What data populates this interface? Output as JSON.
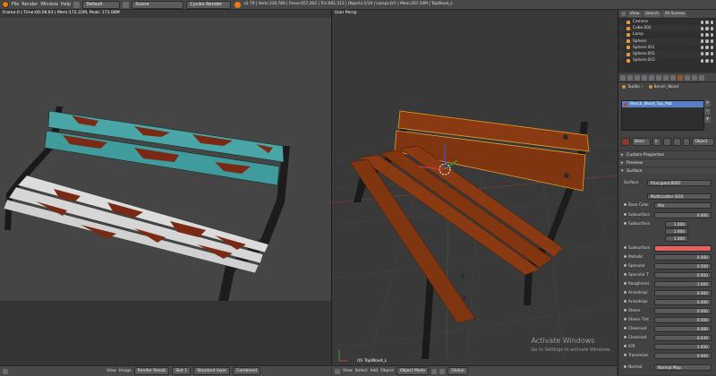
{
  "topbar": {
    "menus": [
      "File",
      "Render",
      "Window",
      "Help"
    ],
    "layout": "Default",
    "scene": "Scene",
    "engine": "Cycles Render",
    "stats": "v2.79 | Verts:330,780 | Faces:657,462 | Tris:661,512 | Objects:1/19 | Lamps:0/1 | Mem:267.10M | TopWood_L"
  },
  "left_viewport": {
    "header": "Frame:0 | Time:00:28.63 | Mem:172.22M, Peak: 173.08M",
    "bottom_items": [
      "View",
      "Image",
      "Render Result",
      "Slot 1",
      "Standard layer",
      "Combined"
    ]
  },
  "right_viewport": {
    "header": "User Persp",
    "footer": "(0) TopWood_L",
    "bottom_items": [
      "View",
      "Select",
      "Add",
      "Object",
      "Object Mode",
      "Global"
    ]
  },
  "watermark": {
    "line1": "Activate Windows",
    "line2": "Go to Settings to activate Windows."
  },
  "outliner": {
    "view": "View",
    "search": "Search",
    "filter": "All Scenes",
    "items": [
      "Camera",
      "Cube.002",
      "Lamp",
      "Sphere",
      "Sphere.001",
      "Sphere.002",
      "Sphere.003"
    ]
  },
  "properties": {
    "breadcrumb_object": "TopWo",
    "breadcrumb_material": "Bench_Wood",
    "material_slot": "Bench_Wood_Top_Mat",
    "mat_name": "Benc",
    "mat_count": "1",
    "link": "Object",
    "panels": [
      "Custom Properties",
      "Preview",
      "Surface"
    ],
    "surface_label": "Surface",
    "surface_shader": "Principled BSDF",
    "distribution": "Multiscatter GGX",
    "base_color_label": "Base Color",
    "base_color_value": "Mix",
    "rows": [
      {
        "label": "Subsurface",
        "value": "0.000"
      },
      {
        "label": "Subsurface",
        "value": "1.000"
      },
      {
        "label": "",
        "value": "1.000"
      },
      {
        "label": "",
        "value": "1.000"
      },
      {
        "label": "Subsurface",
        "value": ""
      },
      {
        "label": "Metallic",
        "value": "0.000"
      },
      {
        "label": "Specular",
        "value": "0.500"
      },
      {
        "label": "Specular T",
        "value": "0.000"
      },
      {
        "label": "Roughness",
        "value": "1.000"
      },
      {
        "label": "Anisotropi",
        "value": "0.000"
      },
      {
        "label": "Anisotropi",
        "value": "0.000"
      },
      {
        "label": "Sheen",
        "value": "0.000"
      },
      {
        "label": "Sheen Tint",
        "value": "0.500"
      },
      {
        "label": "Clearcoat",
        "value": "0.000"
      },
      {
        "label": "Clearcoat",
        "value": "0.030"
      },
      {
        "label": "IOR",
        "value": "1.450"
      },
      {
        "label": "Transmissi",
        "value": "0.000"
      }
    ],
    "normal_label": "Normal",
    "normal_value": "Normal Map"
  },
  "colors": {
    "accent": "#e87d0d",
    "selected": "#5680c2",
    "subsurface_color": "#e86060",
    "wood": "#8a3a12",
    "paint_teal": "#4aa6a6"
  }
}
